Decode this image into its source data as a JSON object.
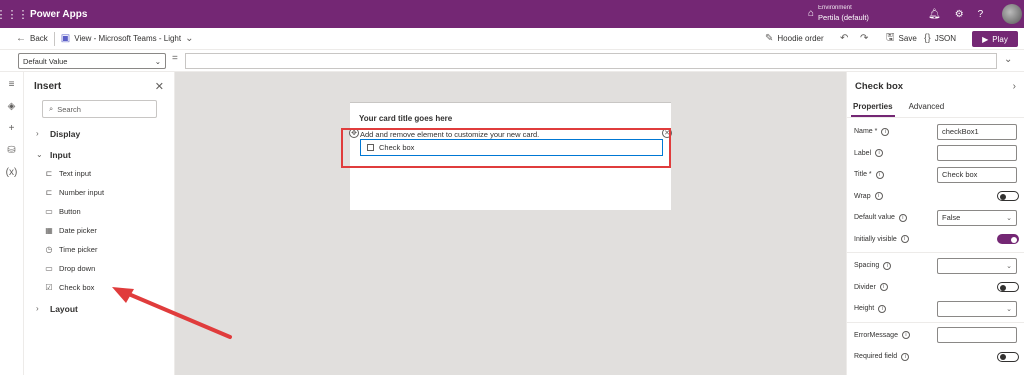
{
  "app": {
    "title": "Power Apps"
  },
  "environment": {
    "label": "Environment",
    "value": "Pertila (default)"
  },
  "command_bar": {
    "back": "Back",
    "view": "View - Microsoft Teams - Light",
    "hoodie": "Hoodie order",
    "save": "Save",
    "json": "JSON",
    "play": "Play"
  },
  "formula": {
    "property": "Default Value",
    "value": ""
  },
  "insert": {
    "title": "Insert",
    "search_placeholder": "Search",
    "groups": {
      "display": "Display",
      "input": "Input",
      "layout": "Layout"
    },
    "items": [
      {
        "label": "Text input",
        "icon": "text-input-icon"
      },
      {
        "label": "Number input",
        "icon": "number-input-icon"
      },
      {
        "label": "Button",
        "icon": "button-icon"
      },
      {
        "label": "Date picker",
        "icon": "calendar-icon"
      },
      {
        "label": "Time picker",
        "icon": "clock-icon"
      },
      {
        "label": "Drop down",
        "icon": "dropdown-icon"
      },
      {
        "label": "Check box",
        "icon": "checkbox-icon"
      }
    ]
  },
  "card": {
    "title": "Your card title goes here",
    "subtitle": "Add and remove element to customize your new card.",
    "checkbox_label": "Check box"
  },
  "properties": {
    "title": "Check box",
    "tabs": [
      "Properties",
      "Advanced"
    ],
    "name_label": "Name *",
    "name_value": "checkBox1",
    "label_label": "Label",
    "label_value": "",
    "title_label": "Title *",
    "title_value": "Check box",
    "wrap_label": "Wrap",
    "default_value_label": "Default value",
    "default_value": "False",
    "initially_visible_label": "Initially visible",
    "spacing_label": "Spacing",
    "spacing_value": "",
    "divider_label": "Divider",
    "height_label": "Height",
    "height_value": "",
    "error_label": "ErrorMessage",
    "error_value": "",
    "required_label": "Required field"
  },
  "colors": {
    "brand": "#742774",
    "annotation": "#e03c3c",
    "focus": "#0078d4"
  }
}
